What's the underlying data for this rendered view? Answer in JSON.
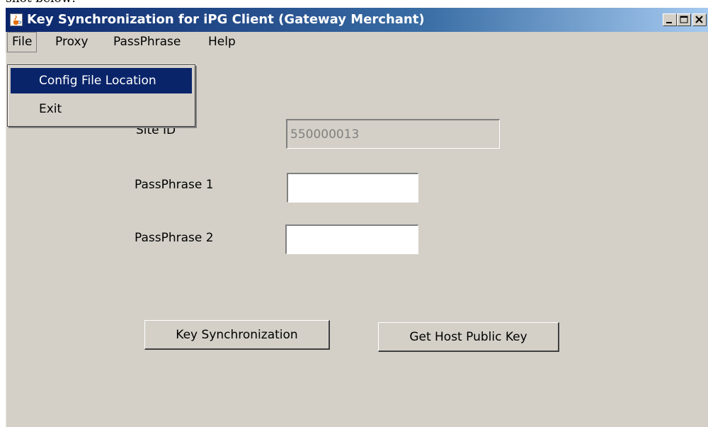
{
  "top_text": "shot below:",
  "window": {
    "title": "Key Synchronization for iPG Client (Gateway Merchant)",
    "app_icon": "java-cup-icon",
    "controls": {
      "minimize": "minimize-icon",
      "maximize": "maximize-icon",
      "close": "close-icon"
    }
  },
  "menubar": {
    "items": [
      {
        "label": "File",
        "active": true
      },
      {
        "label": "Proxy"
      },
      {
        "label": "PassPhrase"
      },
      {
        "label": "Help"
      }
    ]
  },
  "file_menu": {
    "items": [
      {
        "label": "Config File Location",
        "selected": true
      },
      {
        "label": "Exit"
      }
    ]
  },
  "form": {
    "site_id": {
      "label": "Site ID",
      "value": "550000013",
      "enabled": false
    },
    "passphrase1": {
      "label": "PassPhrase 1",
      "value": ""
    },
    "passphrase2": {
      "label": "PassPhrase 2",
      "value": ""
    }
  },
  "buttons": {
    "key_sync": "Key Synchronization",
    "host_key": "Get Host Public Key"
  },
  "colors": {
    "title_gradient_start": "#0a246a",
    "title_gradient_end": "#a6caf0",
    "window_bg": "#d4d0c8",
    "menu_selection": "#0a246a"
  }
}
